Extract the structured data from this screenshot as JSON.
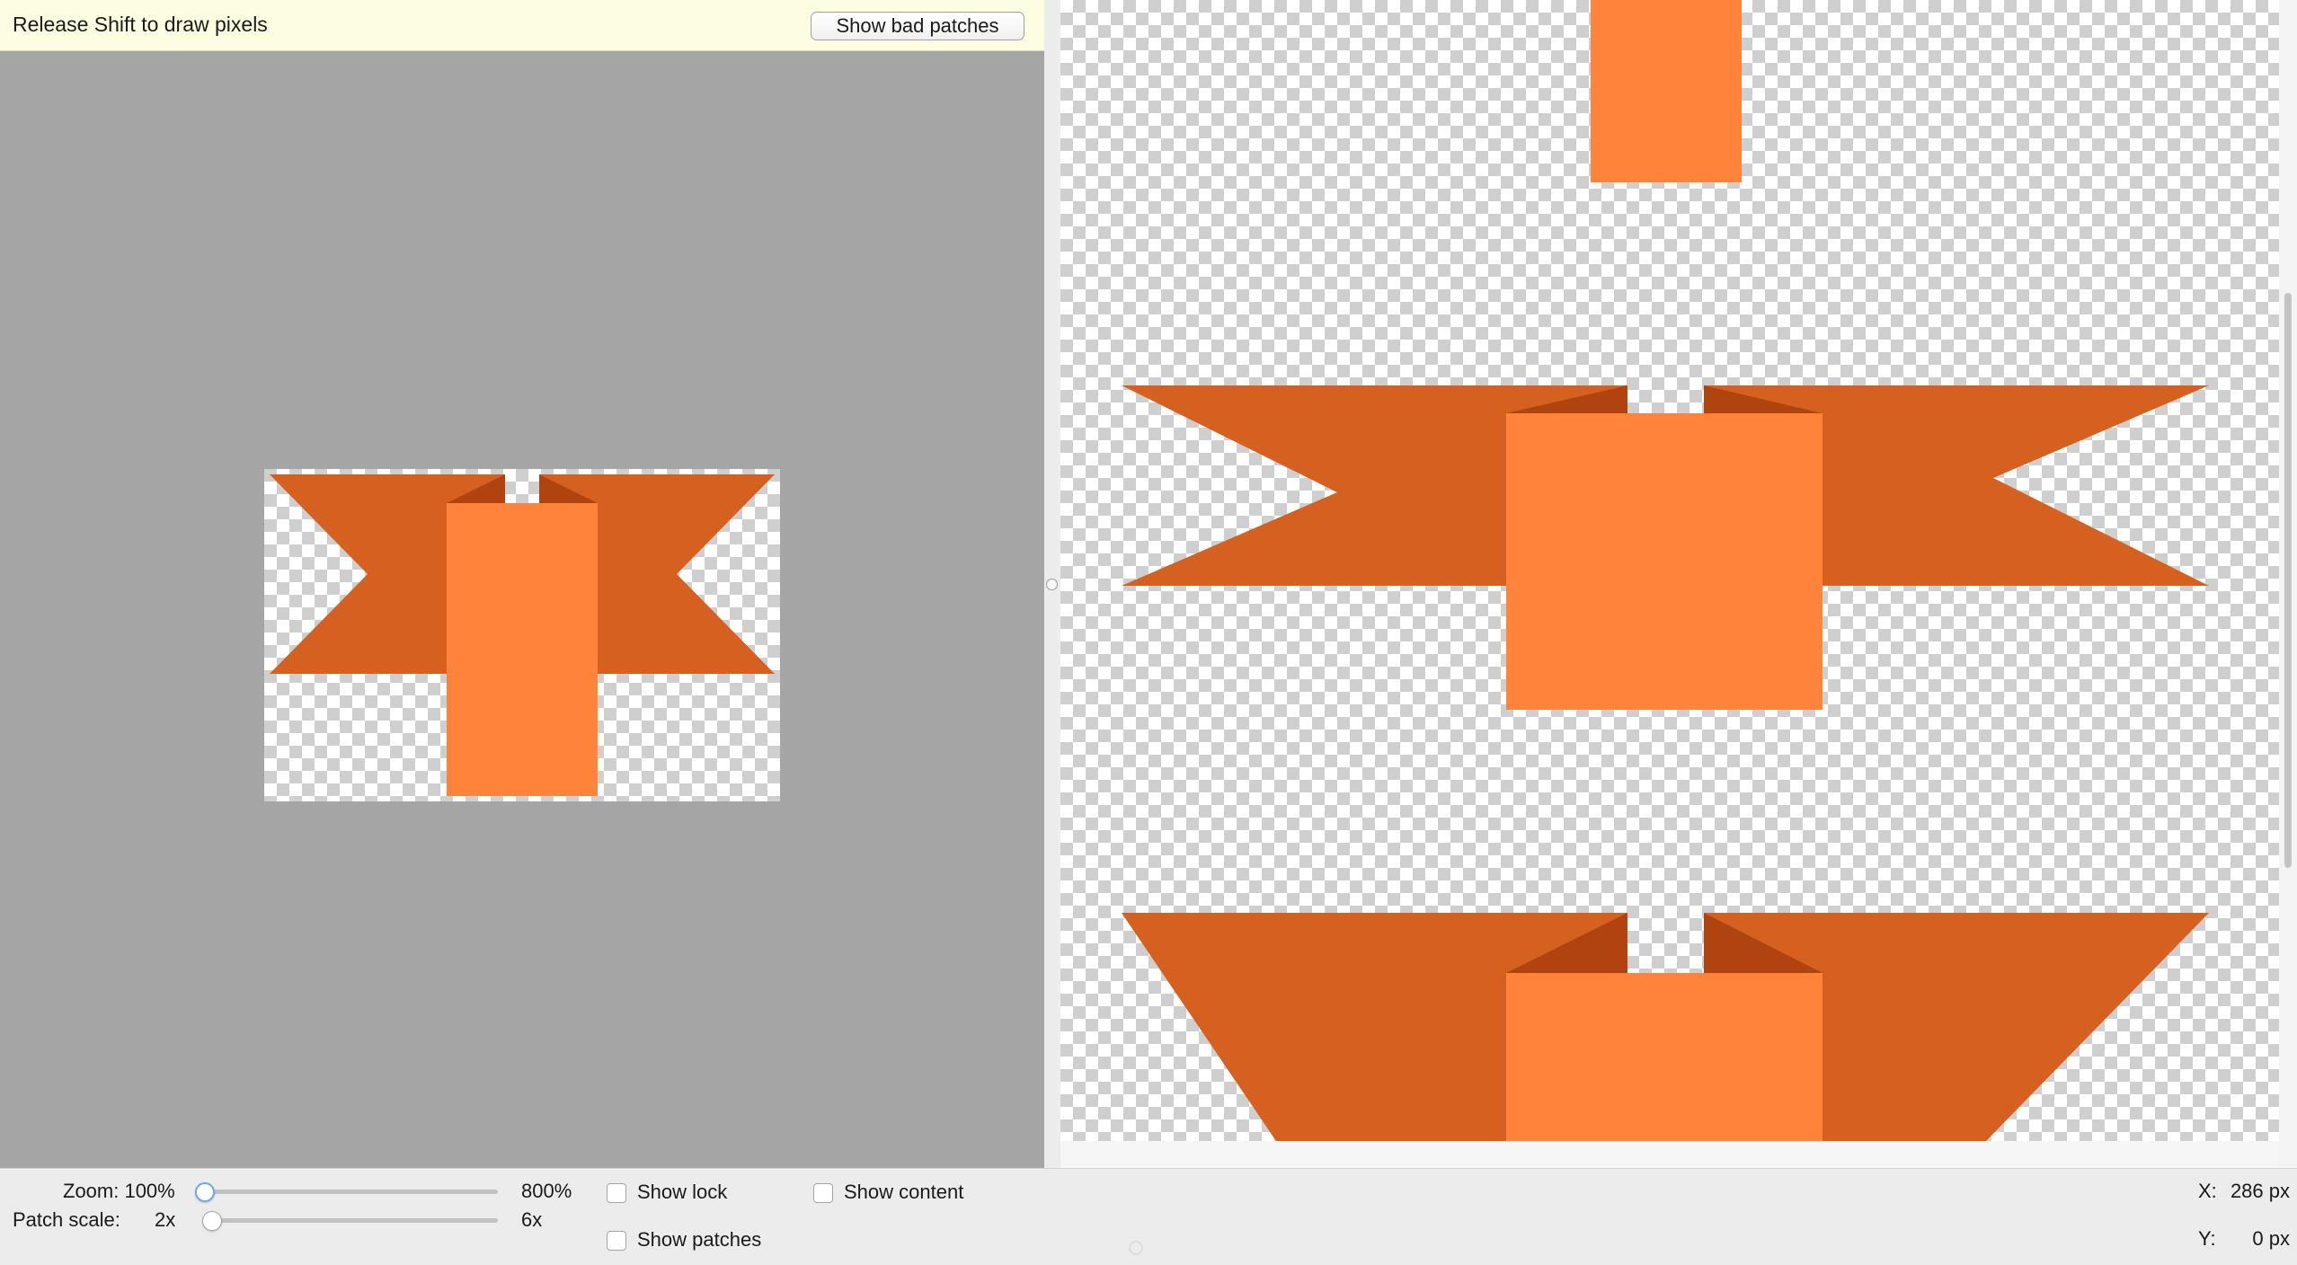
{
  "hint_bar": {
    "message": "Release Shift to draw pixels",
    "show_bad_patches_label": "Show bad patches"
  },
  "controls": {
    "zoom": {
      "label": "Zoom: 100%",
      "max_label": "800%",
      "value_percent": 100,
      "min_percent": 100,
      "max_percent": 800
    },
    "patch_scale": {
      "label": "Patch scale:",
      "min_label": "2x",
      "max_label": "6x",
      "value": 2,
      "min": 2,
      "max": 6
    },
    "show_lock": {
      "label": "Show lock",
      "checked": false
    },
    "show_content": {
      "label": "Show content",
      "checked": false
    },
    "show_patches": {
      "label": "Show patches",
      "checked": false
    }
  },
  "coords": {
    "x_label": "X:",
    "x_value": "286 px",
    "y_label": "Y:",
    "y_value": "0 px"
  },
  "colors": {
    "editor_background": "#a5a5a5",
    "hint_background": "#fdfde1",
    "ribbon": "#d5601f",
    "ribbon_fold": "#b04410",
    "tab": "#ff833a",
    "checker_light": "#ffffff",
    "checker_dark": "#cfcfcf",
    "slider_focus": "#6fa8e6"
  },
  "icons": {
    "cursor": "crosshair-circle-icon",
    "slider_knob": "circle-knob-icon"
  }
}
